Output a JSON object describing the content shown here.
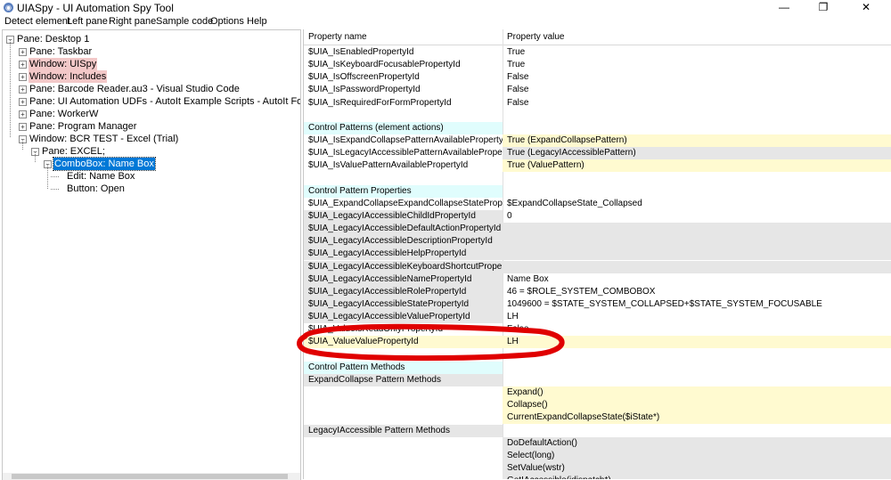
{
  "window": {
    "title": "UIASpy - UI Automation Spy Tool",
    "icon": "app-icon",
    "minimize": "—",
    "restore": "❐",
    "close": "✕"
  },
  "menu": [
    "Detect element",
    "Left pane",
    "Right pane",
    "Sample code",
    "Options",
    "Help"
  ],
  "tree": [
    {
      "label": "Pane: Desktop 1",
      "expander": "−",
      "highlight": "none"
    },
    {
      "label": "Pane: Taskbar",
      "expander": "+",
      "highlight": "none"
    },
    {
      "label": "Window: UISpy",
      "expander": "+",
      "highlight": "pink"
    },
    {
      "label": "Window: Includes",
      "expander": "+",
      "highlight": "pink"
    },
    {
      "label": "Pane: Barcode Reader.au3 - Visual Studio Code",
      "expander": "+",
      "highlight": "none"
    },
    {
      "label": "Pane: UI Automation UDFs - AutoIt Example Scripts - AutoIt Forums - Google",
      "expander": "+",
      "highlight": "none"
    },
    {
      "label": "Pane: WorkerW",
      "expander": "+",
      "highlight": "none"
    },
    {
      "label": "Pane: Program Manager",
      "expander": "+",
      "highlight": "none"
    },
    {
      "label": "Window: BCR TEST - Excel (Trial)",
      "expander": "−",
      "highlight": "none"
    },
    {
      "label": "Pane: EXCEL;",
      "expander": "−",
      "highlight": "none"
    },
    {
      "label": "ComboBox: Name Box",
      "expander": "−",
      "highlight": "selected"
    },
    {
      "label": "Edit: Name Box",
      "expander": "",
      "highlight": "none"
    },
    {
      "label": "Button: Open",
      "expander": "",
      "highlight": "none"
    }
  ],
  "properties": {
    "header": {
      "name": "Property name",
      "value": "Property value"
    },
    "rows": [
      {
        "name": "$UIA_IsEnabledPropertyId",
        "value": "True",
        "nbg": "",
        "vbg": ""
      },
      {
        "name": "$UIA_IsKeyboardFocusablePropertyId",
        "value": "True",
        "nbg": "",
        "vbg": ""
      },
      {
        "name": "$UIA_IsOffscreenPropertyId",
        "value": "False",
        "nbg": "",
        "vbg": ""
      },
      {
        "name": "$UIA_IsPasswordPropertyId",
        "value": "False",
        "nbg": "",
        "vbg": ""
      },
      {
        "name": "$UIA_IsRequiredForFormPropertyId",
        "value": "False",
        "nbg": "",
        "vbg": ""
      },
      {
        "name": "",
        "value": "",
        "nbg": "",
        "vbg": ""
      },
      {
        "name": "Control Patterns (element actions)",
        "value": "",
        "nbg": "cyan",
        "vbg": ""
      },
      {
        "name": "$UIA_IsExpandCollapsePatternAvailablePropertyId",
        "value": "True (ExpandCollapsePattern)",
        "nbg": "",
        "vbg": "yellow"
      },
      {
        "name": "$UIA_IsLegacyIAccessiblePatternAvailablePropertyId",
        "value": "True (LegacyIAccessiblePattern)",
        "nbg": "",
        "vbg": "grey"
      },
      {
        "name": "$UIA_IsValuePatternAvailablePropertyId",
        "value": "True (ValuePattern)",
        "nbg": "",
        "vbg": "yellow"
      },
      {
        "name": "",
        "value": "",
        "nbg": "",
        "vbg": ""
      },
      {
        "name": "Control Pattern Properties",
        "value": "",
        "nbg": "cyan",
        "vbg": ""
      },
      {
        "name": "$UIA_ExpandCollapseExpandCollapseStatePropertyId",
        "value": "$ExpandCollapseState_Collapsed",
        "nbg": "",
        "vbg": ""
      },
      {
        "name": "$UIA_LegacyIAccessibleChildIdPropertyId",
        "value": "0",
        "nbg": "grey",
        "vbg": ""
      },
      {
        "name": "$UIA_LegacyIAccessibleDefaultActionPropertyId",
        "value": "",
        "nbg": "grey",
        "vbg": "grey"
      },
      {
        "name": "$UIA_LegacyIAccessibleDescriptionPropertyId",
        "value": "",
        "nbg": "grey",
        "vbg": "grey"
      },
      {
        "name": "$UIA_LegacyIAccessibleHelpPropertyId",
        "value": "",
        "nbg": "grey",
        "vbg": "grey"
      },
      {
        "name": "$UIA_LegacyIAccessibleKeyboardShortcutPropertyId",
        "value": "",
        "nbg": "grey",
        "vbg": "grey"
      },
      {
        "name": "$UIA_LegacyIAccessibleNamePropertyId",
        "value": "Name Box",
        "nbg": "grey",
        "vbg": ""
      },
      {
        "name": "$UIA_LegacyIAccessibleRolePropertyId",
        "value": "46 = $ROLE_SYSTEM_COMBOBOX",
        "nbg": "grey",
        "vbg": ""
      },
      {
        "name": "$UIA_LegacyIAccessibleStatePropertyId",
        "value": "1049600 = $STATE_SYSTEM_COLLAPSED+$STATE_SYSTEM_FOCUSABLE",
        "nbg": "grey",
        "vbg": ""
      },
      {
        "name": "$UIA_LegacyIAccessibleValuePropertyId",
        "value": "LH",
        "nbg": "grey",
        "vbg": ""
      },
      {
        "name": "$UIA_ValueIsReadOnlyPropertyId",
        "value": "False",
        "nbg": "",
        "vbg": ""
      },
      {
        "name": "$UIA_ValueValuePropertyId",
        "value": "LH",
        "nbg": "yellow",
        "vbg": "yellow"
      },
      {
        "name": "",
        "value": "",
        "nbg": "",
        "vbg": ""
      },
      {
        "name": "Control Pattern Methods",
        "value": "",
        "nbg": "cyan",
        "vbg": ""
      },
      {
        "name": "ExpandCollapse Pattern Methods",
        "value": "",
        "nbg": "grey",
        "vbg": ""
      },
      {
        "name": "",
        "value": "Expand()",
        "nbg": "",
        "vbg": "yellow"
      },
      {
        "name": "",
        "value": "Collapse()",
        "nbg": "",
        "vbg": "yellow"
      },
      {
        "name": "",
        "value": "CurrentExpandCollapseState($iState*)",
        "nbg": "",
        "vbg": "yellow"
      },
      {
        "name": "LegacyIAccessible Pattern Methods",
        "value": "",
        "nbg": "grey",
        "vbg": ""
      },
      {
        "name": "",
        "value": "DoDefaultAction()",
        "nbg": "",
        "vbg": "grey"
      },
      {
        "name": "",
        "value": "Select(long)",
        "nbg": "",
        "vbg": "grey"
      },
      {
        "name": "",
        "value": "SetValue(wstr)",
        "nbg": "",
        "vbg": "grey"
      },
      {
        "name": "",
        "value": "GetIAccessible(idispatch*)",
        "nbg": "",
        "vbg": "grey"
      }
    ]
  },
  "annotation": {
    "shape": "red-ellipse",
    "color": "#e00000"
  }
}
